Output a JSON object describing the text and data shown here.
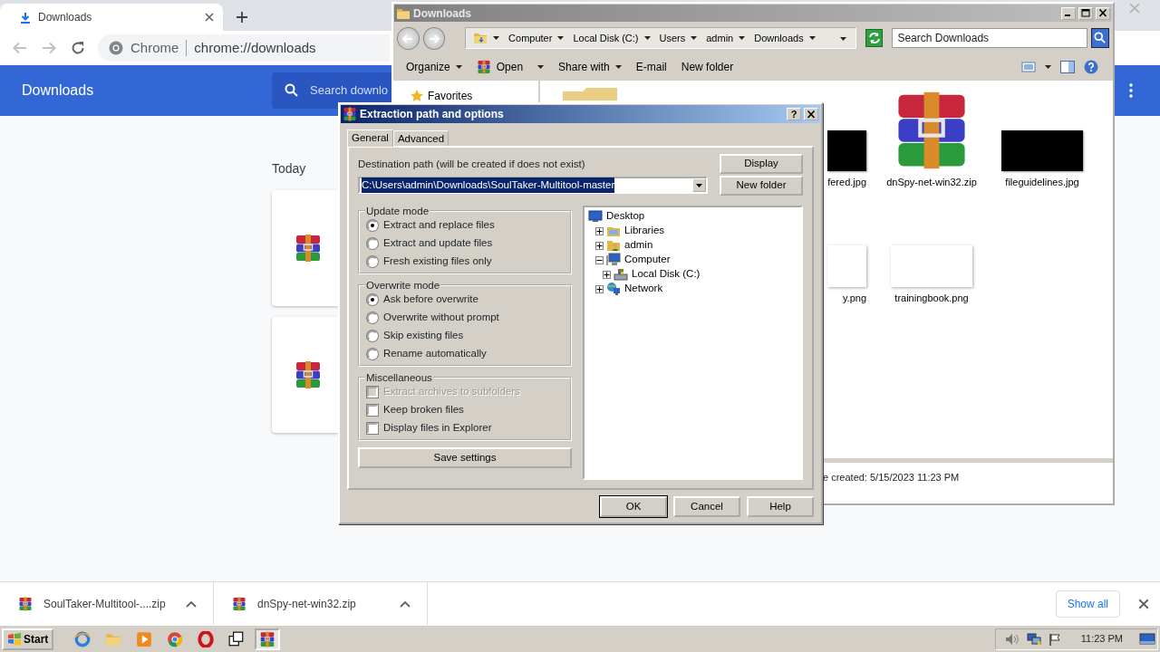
{
  "chrome": {
    "tab": {
      "title": "Downloads"
    },
    "omnibox": {
      "chip": "Chrome",
      "url": "chrome://downloads"
    },
    "header": {
      "title": "Downloads",
      "search": {
        "placeholder": "Search downlo"
      }
    },
    "section_label": "Today",
    "cards": [
      {
        "kind": "archive"
      },
      {
        "kind": "archive"
      }
    ],
    "shelf": {
      "items": [
        {
          "name": "SoulTaker-Multitool-....zip"
        },
        {
          "name": "dnSpy-net-win32.zip"
        }
      ],
      "show_all": "Show all"
    }
  },
  "explorer": {
    "title": "Downloads",
    "breadcrumb": [
      "Computer",
      "Local Disk (C:)",
      "Users",
      "admin",
      "Downloads"
    ],
    "search": {
      "placeholder": "Search Downloads"
    },
    "toolbar": [
      {
        "label": "Organize",
        "kind": "menu"
      },
      {
        "label": "Open",
        "kind": "split"
      },
      {
        "label": "Share with",
        "kind": "menu"
      },
      {
        "label": "E-mail",
        "kind": "plain"
      },
      {
        "label": "New folder",
        "kind": "plain"
      }
    ],
    "nav": [
      {
        "label": "Favorites"
      }
    ],
    "files": [
      {
        "name": "fered.jpg",
        "kind": "dark-image"
      },
      {
        "name": "dnSpy-net-win32.zip",
        "kind": "archive"
      },
      {
        "name": "fileguidelines.jpg",
        "kind": "dark-image"
      },
      {
        "name": "y.png",
        "kind": "light-image"
      },
      {
        "name": "trainingbook.png",
        "kind": "light-image"
      }
    ],
    "details": "e created: 5/15/2023 11:23 PM"
  },
  "dialog": {
    "title": "Extraction path and options",
    "help": "?",
    "tabs": [
      {
        "label": "General",
        "selected": true
      },
      {
        "label": "Advanced",
        "selected": false
      }
    ],
    "path_label": "Destination path (will be created if does not exist)",
    "path": {
      "value": "C:\\Users\\admin\\Downloads\\SoulTaker-Multitool-master",
      "highlighted": true
    },
    "side_buttons": [
      "Display",
      "New folder"
    ],
    "groups": [
      {
        "title": "Update mode",
        "kind": "radio",
        "options": [
          {
            "label": "Extract and replace files",
            "selected": true
          },
          {
            "label": "Extract and update files",
            "selected": false
          },
          {
            "label": "Fresh existing files only",
            "selected": false
          }
        ]
      },
      {
        "title": "Overwrite mode",
        "kind": "radio",
        "options": [
          {
            "label": "Ask before overwrite",
            "selected": true
          },
          {
            "label": "Overwrite without prompt",
            "selected": false
          },
          {
            "label": "Skip existing files",
            "selected": false
          },
          {
            "label": "Rename automatically",
            "selected": false
          }
        ]
      },
      {
        "title": "Miscellaneous",
        "kind": "checkbox",
        "options": [
          {
            "label": "Extract archives to subfolders",
            "checked": false,
            "disabled": true
          },
          {
            "label": "Keep broken files",
            "checked": false,
            "disabled": false
          },
          {
            "label": "Display files in Explorer",
            "checked": false,
            "disabled": false
          }
        ]
      }
    ],
    "save_button": "Save settings",
    "tree": [
      {
        "label": "Desktop",
        "kind": "desktop",
        "children": [
          {
            "label": "Libraries",
            "kind": "libraries",
            "expanded": false
          },
          {
            "label": "admin",
            "kind": "user",
            "expanded": false
          },
          {
            "label": "Computer",
            "kind": "computer",
            "expanded": true,
            "children": [
              {
                "label": "Local Disk (C:)",
                "kind": "disk",
                "expanded": false
              }
            ]
          },
          {
            "label": "Network",
            "kind": "network",
            "expanded": false
          }
        ]
      }
    ],
    "buttons": [
      {
        "label": "OK",
        "default": true
      },
      {
        "label": "Cancel",
        "default": false
      },
      {
        "label": "Help",
        "default": false
      }
    ]
  },
  "taskbar": {
    "start": "Start",
    "tasks": [
      {
        "kind": "ie",
        "selected": false
      },
      {
        "kind": "folder",
        "selected": false
      },
      {
        "kind": "media",
        "selected": false
      },
      {
        "kind": "chrome",
        "selected": false
      },
      {
        "kind": "opera",
        "selected": false
      },
      {
        "kind": "switch",
        "selected": false
      },
      {
        "kind": "winrar",
        "selected": true
      }
    ],
    "clock": "11:23 PM"
  }
}
